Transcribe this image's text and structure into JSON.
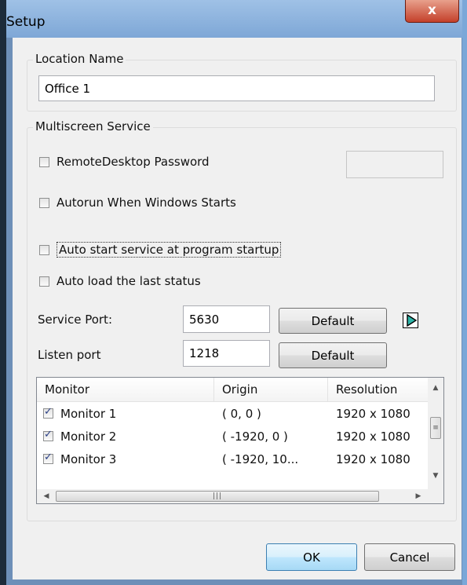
{
  "window": {
    "title": "Setup",
    "close_glyph": "x"
  },
  "location_group": {
    "label": "Location Name",
    "value": "Office 1"
  },
  "service_group": {
    "label": "Multiscreen Service",
    "remote_password": {
      "label": "RemoteDesktop Password",
      "checked": false,
      "value": ""
    },
    "autorun": {
      "label": "Autorun When Windows Starts",
      "checked": false
    },
    "auto_start": {
      "label": "Auto start service at program startup",
      "checked": false
    },
    "auto_load": {
      "label": "Auto load the last status",
      "checked": false
    },
    "service_port": {
      "label": "Service Port:",
      "value": "5630",
      "default_label": "Default"
    },
    "listen_port": {
      "label": "Listen port",
      "value": "1218",
      "default_label": "Default"
    },
    "play_icon": "play-arrow-icon",
    "monitors": {
      "columns": [
        "Monitor",
        "Origin",
        "Resolution"
      ],
      "rows": [
        {
          "checked": true,
          "name": "Monitor 1",
          "origin": "( 0, 0 )",
          "resolution": "1920 x 1080"
        },
        {
          "checked": true,
          "name": "Monitor 2",
          "origin": "( -1920, 0 )",
          "resolution": "1920 x 1080"
        },
        {
          "checked": true,
          "name": "Monitor 3",
          "origin": "( -1920, 10...",
          "resolution": "1920 x 1080"
        }
      ]
    }
  },
  "buttons": {
    "ok": "OK",
    "cancel": "Cancel"
  },
  "colors": {
    "accent": "#3c7fb1",
    "play_icon": "#2db5a8"
  }
}
